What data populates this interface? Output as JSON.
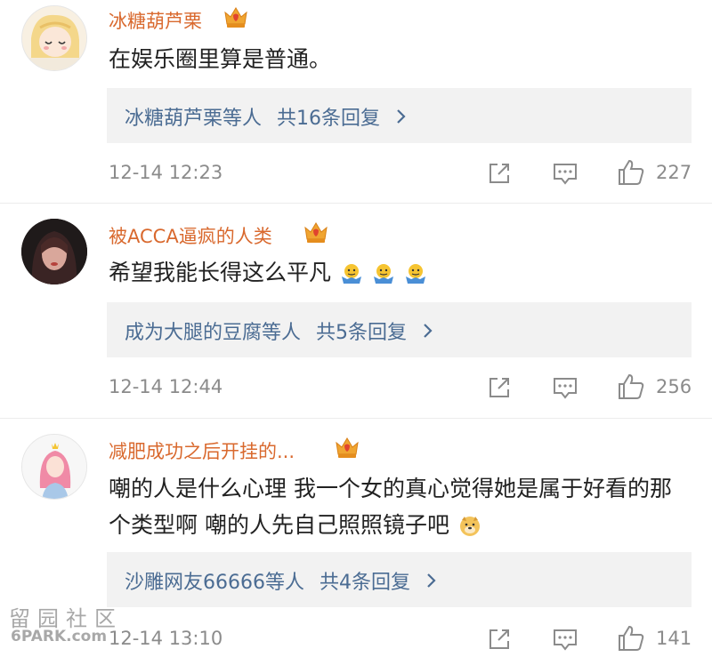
{
  "comments": [
    {
      "username": "冰糖葫芦栗",
      "text": "在娱乐圈里算是普通。",
      "replies": {
        "users": "冰糖葫芦栗等人",
        "count": "共16条回复"
      },
      "time": "12-14 12:23",
      "likes": "227"
    },
    {
      "username": "被ACCA逼疯的人类",
      "text": "希望我能长得这么平凡",
      "replies": {
        "users": "成为大腿的豆腐等人",
        "count": "共5条回复"
      },
      "time": "12-14 12:44",
      "likes": "256"
    },
    {
      "username": "减肥成功之后开挂的...",
      "text": "嘲的人是什么心理 我一个女的真心觉得她是属于好看的那个类型啊  嘲的人先自己照照镜子吧",
      "replies": {
        "users": "沙雕网友66666等人",
        "count": "共4条回复"
      },
      "time": "12-14 13:10",
      "likes": "141"
    }
  ],
  "watermark": {
    "line1": "留园社区",
    "line2": "6PARK.com"
  },
  "icons": {
    "crown": "vip-crown-icon",
    "share": "share-icon",
    "comment": "comment-icon",
    "like": "thumbs-up-icon",
    "chevron": "chevron-right-icon",
    "emoji": "shrug-emoji-icon"
  },
  "colors": {
    "username": "#d9692e",
    "reply_link": "#4b6c93",
    "meta": "#8b8b8b"
  }
}
